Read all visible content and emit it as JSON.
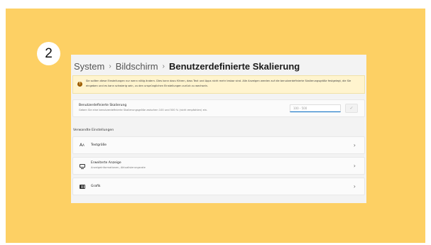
{
  "step": "2",
  "breadcrumb": {
    "item1": "System",
    "item2": "Bildschirm",
    "current": "Benutzerdefinierte Skalierung",
    "separator": "›"
  },
  "warning": {
    "text": "Sie sollten diese Einstellungen nur wenn nötig ändern. Dies kann dazu führen, dass Text und Apps nicht mehr lesbar sind. Alle Anzeigen werden auf die benutzerdefinierte Skalierungsgröße festgelegt, die Sie eingeben und es kann schwierig sein, zu den ursprünglichen Einstellungen zurück zu wechseln."
  },
  "custom_scaling": {
    "title": "Benutzerdefinierte Skalierung",
    "description": "Geben Sie eine benutzerdefinierte Skalierungsgröße zwischen 100 und 500 % (nicht empfohlen) ein.",
    "input_placeholder": "100 - 500",
    "confirm_icon": "checkmark-icon"
  },
  "related": {
    "heading": "Verwandte Einstellungen",
    "items": [
      {
        "label": "Textgröße",
        "sub": "",
        "icon": "text-size-icon"
      },
      {
        "label": "Erweiterte Anzeige",
        "sub": "Anzeigeinformationen, Aktualisierungsrate",
        "icon": "monitor-icon"
      },
      {
        "label": "Grafik",
        "sub": "",
        "icon": "graphics-card-icon"
      }
    ]
  },
  "colors": {
    "background": "#fdd064",
    "accent": "#0067c0",
    "warning_bg": "#fff4ce"
  }
}
